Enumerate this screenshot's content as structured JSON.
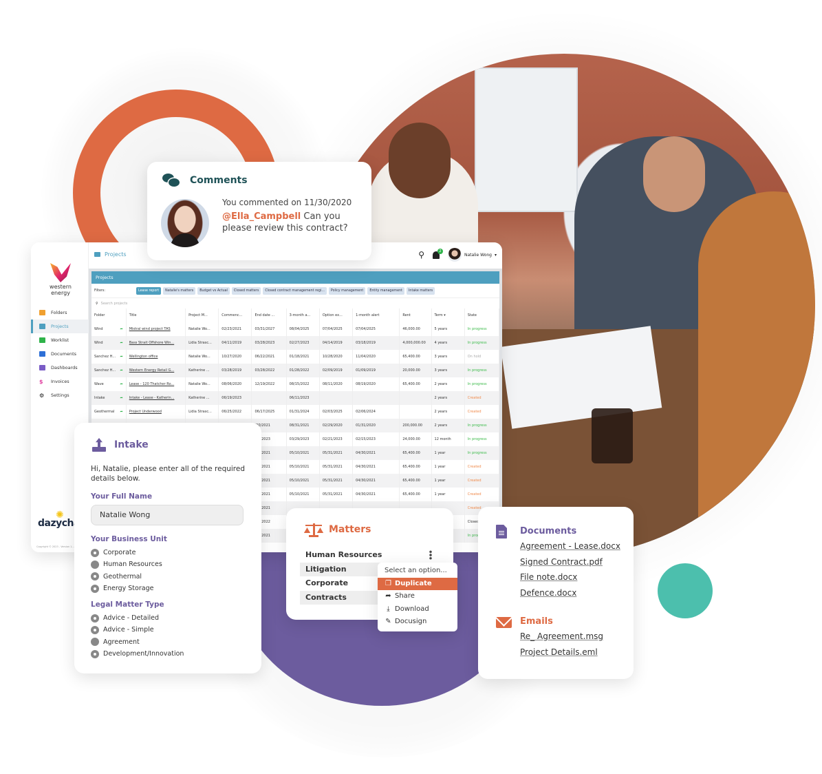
{
  "colors": {
    "orange": "#de6a43",
    "purple": "#6c5c9e",
    "teal": "#4cbfad",
    "app_accent": "#4e9fbf",
    "comments_heading": "#1f5257",
    "status_in_progress": "#3cbb4a",
    "status_created": "#f08a4b",
    "status_on_hold": "#aaaaaa"
  },
  "app": {
    "brand": "western energy",
    "breadcrumb": "Projects",
    "user_name": "Natalie Wong",
    "notification_count": "2",
    "sidebar": {
      "items": [
        {
          "label": "Folders",
          "icon": "folder-icon",
          "color": "#f0a030",
          "active": false
        },
        {
          "label": "Projects",
          "icon": "briefcase-icon",
          "color": "#4e9fbf",
          "active": true
        },
        {
          "label": "Worklist",
          "icon": "list-icon",
          "color": "#2fb34a",
          "active": false
        },
        {
          "label": "Documents",
          "icon": "document-icon",
          "color": "#2d6fd6",
          "active": false
        },
        {
          "label": "Dashboards",
          "icon": "bar-chart-icon",
          "color": "#7a5cc6",
          "active": false
        },
        {
          "label": "Invoices",
          "icon": "dollar-icon",
          "color": "#e040a0",
          "active": false
        },
        {
          "label": "Settings",
          "icon": "gear-icon",
          "color": "#111111",
          "active": false
        }
      ],
      "footer_logo": "dazycha",
      "copyright": "Copyright © 2023 - Version 1..."
    },
    "panel_title": "Projects",
    "filters_label": "Filters:",
    "filters": [
      {
        "label": "Lease report",
        "active": true
      },
      {
        "label": "Natalie's matters",
        "active": false
      },
      {
        "label": "Budget vs Actual",
        "active": false
      },
      {
        "label": "Closed matters",
        "active": false
      },
      {
        "label": "Closed contract management regi...",
        "active": false
      },
      {
        "label": "Policy management",
        "active": false
      },
      {
        "label": "Entity management",
        "active": false
      },
      {
        "label": "Intake matters",
        "active": false
      }
    ],
    "search_placeholder": "Search projects",
    "table": {
      "columns": [
        "Folder",
        "Title",
        "Project M...",
        "Commenc...",
        "End date ...",
        "3-month a...",
        "Option ex...",
        "1-month alert",
        "Rent",
        "Term ▾",
        "State"
      ],
      "rows": [
        [
          "Wind",
          "Mistral wind project TAS",
          "Natalie Wo...",
          "02/23/2021",
          "03/31/2027",
          "08/04/2025",
          "07/04/2025",
          "07/04/2025",
          "46,000.00",
          "5 years",
          "In progress"
        ],
        [
          "Wind",
          "Bass Strait Offshore Win...",
          "Lidia Strasc...",
          "04/11/2019",
          "03/28/2023",
          "02/27/2023",
          "04/14/2019",
          "03/18/2019",
          "4,000,000.00",
          "4 years",
          "In progress"
        ],
        [
          "Sanchez H...",
          "Wellington office",
          "Natalie Wo...",
          "10/27/2020",
          "06/22/2021",
          "01/18/2021",
          "10/28/2020",
          "11/04/2020",
          "65,400.00",
          "3 years",
          "On hold"
        ],
        [
          "Sanchez H...",
          "Western Energy Retail G...",
          "Katherine ...",
          "03/28/2019",
          "03/28/2022",
          "01/28/2022",
          "02/09/2019",
          "01/09/2019",
          "20,000.00",
          "3 years",
          "In progress"
        ],
        [
          "Wave",
          "Lease - 120 Thatcher Ro...",
          "Natalie Wo...",
          "08/06/2020",
          "12/19/2022",
          "08/15/2022",
          "08/11/2020",
          "08/19/2020",
          "65,400.00",
          "2 years",
          "In progress"
        ],
        [
          "Intake",
          "Intake - Lease - Katherin...",
          "Katherine ...",
          "06/19/2023",
          "",
          "06/11/2023",
          "",
          "",
          "",
          "2 years",
          "Created"
        ],
        [
          "Geothermal",
          "Project Underwood",
          "Lidia Strasc...",
          "06/25/2022",
          "06/17/2025",
          "01/31/2024",
          "02/03/2025",
          "02/06/2024",
          "",
          "2 years",
          "Created"
        ],
        [
          "",
          "",
          "",
          "",
          "/30/2021",
          "08/31/2021",
          "02/29/2020",
          "01/31/2020",
          "200,000.00",
          "2 years",
          "In progress"
        ],
        [
          "",
          "",
          "",
          "",
          "/18/2023",
          "03/29/2023",
          "02/21/2023",
          "02/15/2023",
          "24,000.00",
          "12 month",
          "In progress"
        ],
        [
          "",
          "",
          "",
          "",
          "/10/2021",
          "05/10/2021",
          "05/31/2021",
          "04/30/2021",
          "65,400.00",
          "1 year",
          "In progress"
        ],
        [
          "",
          "",
          "",
          "",
          "/10/2021",
          "05/10/2021",
          "05/31/2021",
          "04/30/2021",
          "65,400.00",
          "1 year",
          "Created"
        ],
        [
          "",
          "",
          "",
          "",
          "/10/2021",
          "05/10/2021",
          "05/31/2021",
          "04/30/2021",
          "65,400.00",
          "1 year",
          "Created"
        ],
        [
          "",
          "",
          "",
          "",
          "/10/2021",
          "05/10/2021",
          "05/31/2021",
          "04/30/2021",
          "65,400.00",
          "1 year",
          "Created"
        ],
        [
          "",
          "",
          "",
          "",
          "/10/2021",
          "",
          "",
          "",
          "",
          "",
          "Created"
        ],
        [
          "",
          "",
          "",
          "",
          "/30/2022",
          "",
          "",
          "",
          "",
          "",
          "Closed"
        ],
        [
          "",
          "",
          "",
          "",
          "/20/2021",
          "",
          "",
          "",
          "",
          "",
          "In progress"
        ]
      ]
    }
  },
  "comments": {
    "title": "Comments",
    "meta": "You commented on 11/30/2020",
    "mention": "@Ella_Campbell",
    "text": " Can you please review this contract?"
  },
  "intake": {
    "title": "Intake",
    "intro": "Hi, Natalie, please enter all of the required details below.",
    "full_name_label": "Your Full Name",
    "full_name_value": "Natalie Wong",
    "business_unit_label": "Your Business Unit",
    "business_units": [
      {
        "label": "Corporate",
        "filled": false
      },
      {
        "label": "Human Resources",
        "filled": true
      },
      {
        "label": "Geothermal",
        "filled": false
      },
      {
        "label": "Energy Storage",
        "filled": false
      }
    ],
    "matter_type_label": "Legal Matter Type",
    "matter_types": [
      {
        "label": "Advice - Detailed",
        "filled": false
      },
      {
        "label": "Advice - Simple",
        "filled": false
      },
      {
        "label": "Agreement",
        "filled": true
      },
      {
        "label": "Development/Innovation",
        "filled": false
      }
    ]
  },
  "matters": {
    "title": "Matters",
    "items": [
      "Human Resources",
      "Litigation",
      "Corporate",
      "Contracts"
    ],
    "menu": {
      "placeholder": "Select an option...",
      "options": [
        {
          "label": "Duplicate",
          "icon": "copy-icon",
          "glyph": "❐",
          "selected": true
        },
        {
          "label": "Share",
          "icon": "share-icon",
          "glyph": "➦",
          "selected": false
        },
        {
          "label": "Download",
          "icon": "download-icon",
          "glyph": "⤓",
          "selected": false
        },
        {
          "label": "Docusign",
          "icon": "signature-icon",
          "glyph": "✎",
          "selected": false
        }
      ]
    }
  },
  "documents": {
    "title": "Documents",
    "files": [
      "Agreement - Lease.docx",
      "Signed Contract.pdf",
      "File note.docx",
      "Defence.docx"
    ],
    "emails_title": "Emails",
    "emails": [
      "Re_ Agreement.msg",
      "Project Details.eml"
    ]
  }
}
